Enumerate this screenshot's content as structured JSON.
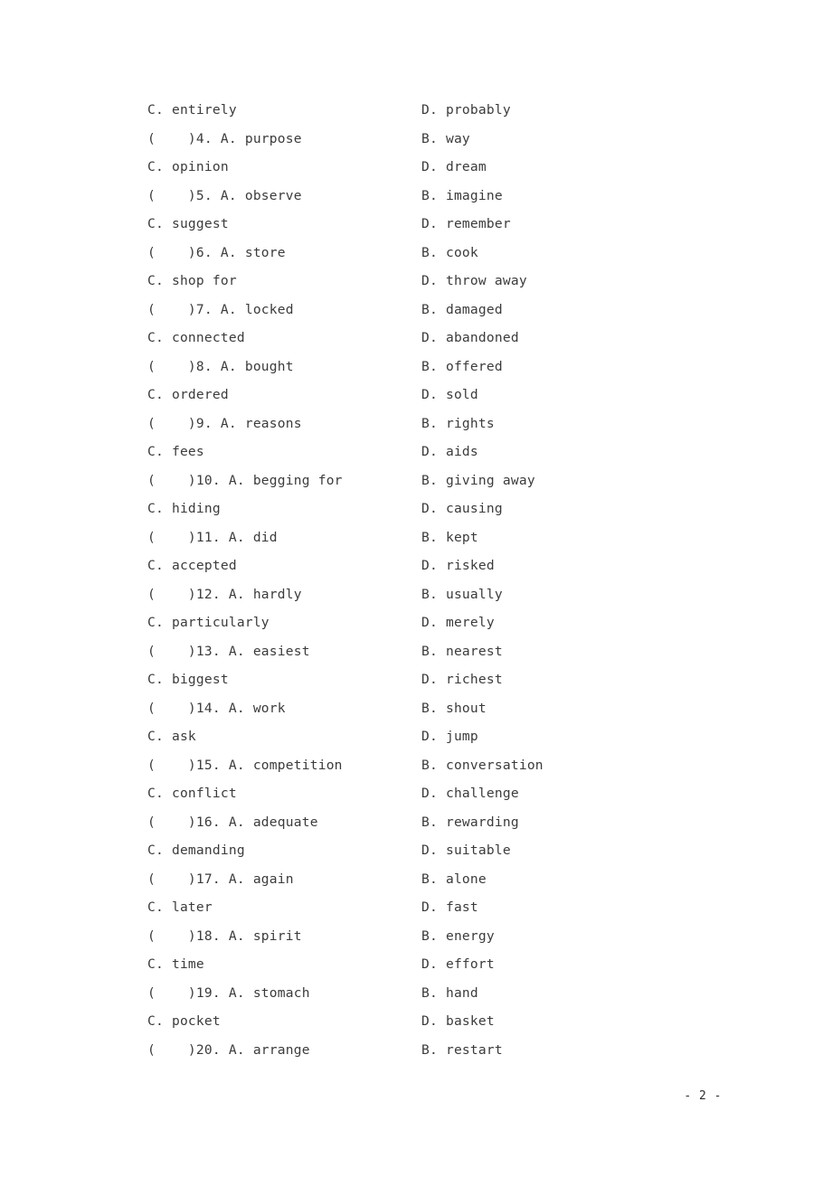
{
  "document": {
    "kind": "exam-worksheet",
    "page_number_label": "- 2 -",
    "background_color": "#ffffff",
    "text_color": "#3b3b3b"
  },
  "lines": [
    {
      "type": "options-cd",
      "left": "C. entirely",
      "right": "D. probably"
    },
    {
      "type": "question",
      "left": "(    )4. A. purpose",
      "right": "B. way"
    },
    {
      "type": "options-cd",
      "left": "C. opinion",
      "right": "D. dream"
    },
    {
      "type": "question",
      "left": "(    )5. A. observe",
      "right": "B. imagine"
    },
    {
      "type": "options-cd",
      "left": "C. suggest",
      "right": "D. remember"
    },
    {
      "type": "question",
      "left": "(    )6. A. store",
      "right": "B. cook"
    },
    {
      "type": "options-cd",
      "left": "C. shop for",
      "right": "D. throw away"
    },
    {
      "type": "question",
      "left": "(    )7. A. locked",
      "right": "B. damaged"
    },
    {
      "type": "options-cd",
      "left": "C. connected",
      "right": "D. abandoned"
    },
    {
      "type": "question",
      "left": "(    )8. A. bought",
      "right": "B. offered"
    },
    {
      "type": "options-cd",
      "left": "C. ordered",
      "right": "D. sold"
    },
    {
      "type": "question",
      "left": "(    )9. A. reasons",
      "right": "B. rights"
    },
    {
      "type": "options-cd",
      "left": "C. fees",
      "right": "D. aids"
    },
    {
      "type": "question",
      "left": "(    )10. A. begging for",
      "right": "B. giving away"
    },
    {
      "type": "options-cd",
      "left": "C. hiding",
      "right": "D. causing"
    },
    {
      "type": "question",
      "left": "(    )11. A. did",
      "right": "B. kept"
    },
    {
      "type": "options-cd",
      "left": "C. accepted",
      "right": "D. risked"
    },
    {
      "type": "question",
      "left": "(    )12. A. hardly",
      "right": "B. usually"
    },
    {
      "type": "options-cd",
      "left": "C. particularly",
      "right": "D. merely"
    },
    {
      "type": "question",
      "left": "(    )13. A. easiest",
      "right": "B. nearest"
    },
    {
      "type": "options-cd",
      "left": "C. biggest",
      "right": "D. richest"
    },
    {
      "type": "question",
      "left": "(    )14. A. work",
      "right": "B. shout"
    },
    {
      "type": "options-cd",
      "left": "C. ask",
      "right": "D. jump"
    },
    {
      "type": "question",
      "left": "(    )15. A. competition",
      "right": "B. conversation"
    },
    {
      "type": "options-cd",
      "left": "C. conflict",
      "right": "D. challenge"
    },
    {
      "type": "question",
      "left": "(    )16. A. adequate",
      "right": "B. rewarding"
    },
    {
      "type": "options-cd",
      "left": "C. demanding",
      "right": "D. suitable"
    },
    {
      "type": "question",
      "left": "(    )17. A. again",
      "right": "B. alone"
    },
    {
      "type": "options-cd",
      "left": "C. later",
      "right": "D. fast"
    },
    {
      "type": "question",
      "left": "(    )18. A. spirit",
      "right": "B. energy"
    },
    {
      "type": "options-cd",
      "left": "C. time",
      "right": "D. effort"
    },
    {
      "type": "question",
      "left": "(    )19. A. stomach",
      "right": "B. hand"
    },
    {
      "type": "options-cd",
      "left": "C. pocket",
      "right": "D. basket"
    },
    {
      "type": "question",
      "left": "(    )20. A. arrange",
      "right": "B. restart"
    }
  ]
}
